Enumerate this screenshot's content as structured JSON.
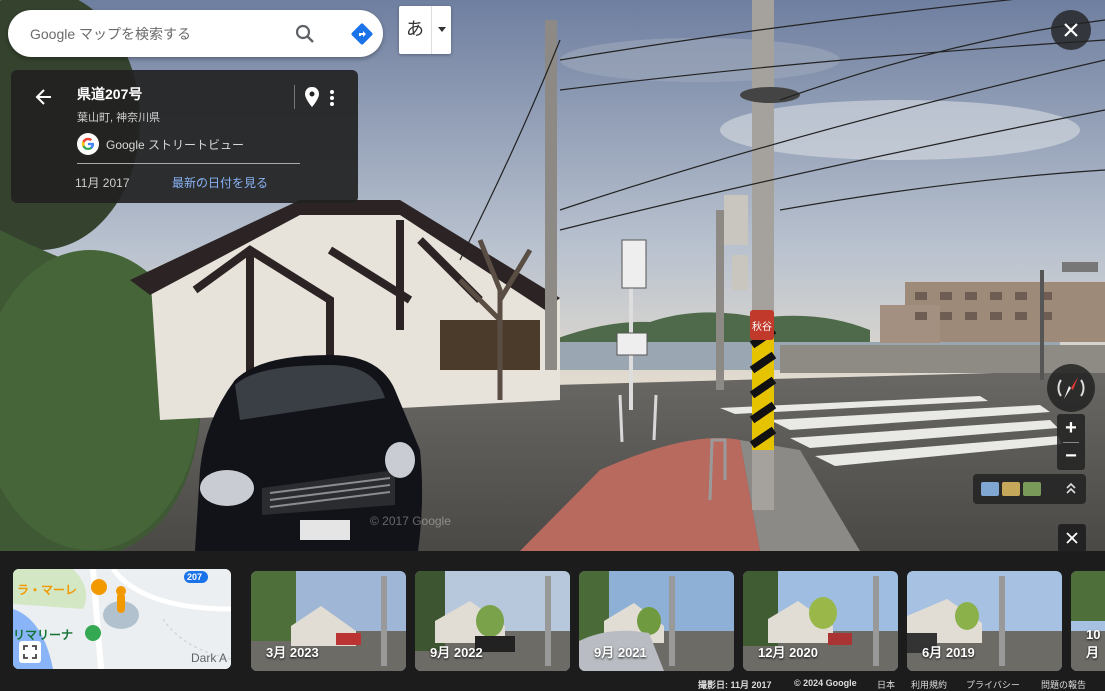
{
  "search": {
    "placeholder": "Google マップを検索する"
  },
  "ime": {
    "char": "あ"
  },
  "card": {
    "title": "県道207号",
    "subtitle": "葉山町, 神奈川県",
    "source": "Google ストリートビュー",
    "date": "11月 2017",
    "latest_link": "最新の日付を見る"
  },
  "minimap": {
    "labels": [
      "ラ・マーレ",
      "リマリーナ",
      "Dark A"
    ],
    "route_badge": "207"
  },
  "thumbnails": [
    {
      "label": "3月 2023"
    },
    {
      "label": "9月 2022"
    },
    {
      "label": "9月 2021"
    },
    {
      "label": "12月 2020"
    },
    {
      "label": "6月 2019"
    },
    {
      "label": "10月"
    }
  ],
  "scene": {
    "watermark": "© 2017 Google",
    "signs": [
      "秋谷"
    ]
  },
  "footer": {
    "capture": "撮影日: 11月 2017",
    "copyright": "© 2024 Google",
    "country": "日本",
    "terms": "利用規約",
    "privacy": "プライバシー",
    "report": "問題の報告"
  },
  "colors": {
    "accent_link": "#8ab4f8",
    "direction_blue": "#1a73e8",
    "card_bg": "#222222"
  }
}
